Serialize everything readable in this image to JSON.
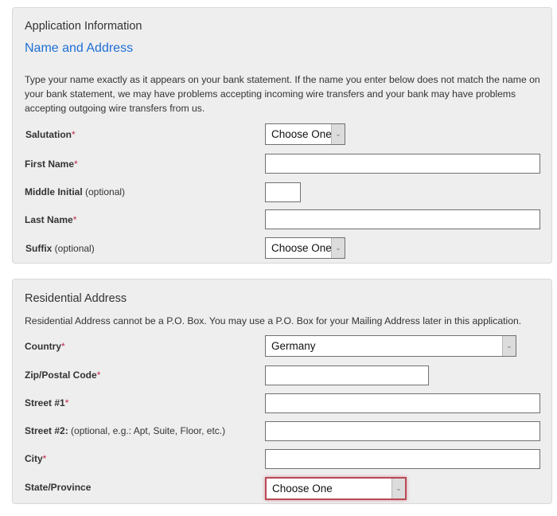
{
  "application_info": {
    "heading": "Application Information",
    "subheading": "Name and Address",
    "instructions": "Type your name exactly as it appears on your bank statement. If the name you enter below does not match the name on your bank statement, we may have problems accepting incoming wire transfers and your bank may have problems accepting outgoing wire transfers from us.",
    "fields": {
      "salutation": {
        "label": "Salutation",
        "required_mark": "*",
        "value": "Choose One"
      },
      "first_name": {
        "label": "First Name",
        "required_mark": "*",
        "value": ""
      },
      "middle_initial": {
        "label": "Middle Initial",
        "hint": " (optional)",
        "value": ""
      },
      "last_name": {
        "label": "Last Name",
        "required_mark": "*",
        "value": ""
      },
      "suffix": {
        "label": "Suffix",
        "hint": " (optional)",
        "value": "Choose One"
      }
    }
  },
  "residential_address": {
    "heading": "Residential Address",
    "note": "Residential Address cannot be a P.O. Box. You may use a P.O. Box for your Mailing Address later in this application.",
    "fields": {
      "country": {
        "label": "Country",
        "required_mark": "*",
        "value": "Germany"
      },
      "zip": {
        "label": "Zip/Postal Code",
        "required_mark": "*",
        "value": ""
      },
      "street1": {
        "label": "Street #1",
        "required_mark": "*",
        "value": ""
      },
      "street2": {
        "label": "Street #2:",
        "hint": " (optional, e.g.: Apt, Suite, Floor, etc.)",
        "value": ""
      },
      "city": {
        "label": "City",
        "required_mark": "*",
        "value": ""
      },
      "state": {
        "label": "State/Province",
        "value": "Choose One"
      }
    }
  },
  "colors": {
    "accent": "#1e6fd6",
    "required": "#c0264a",
    "invalid_border": "#b84a55",
    "panel_bg": "#eeeeee"
  },
  "icons": {
    "dropdown": "chevron-down-icon"
  }
}
